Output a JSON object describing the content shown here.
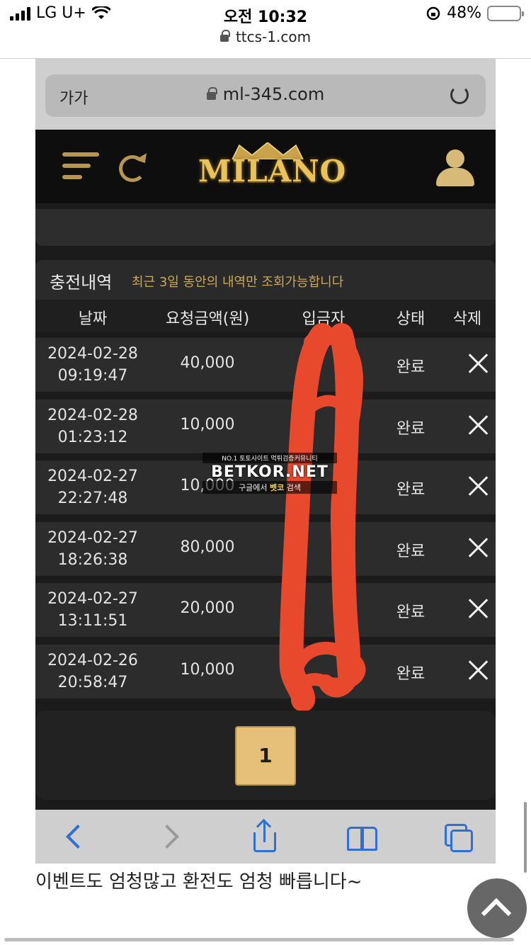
{
  "status_bar": {
    "carrier": "LG U+",
    "time": "오전 10:32",
    "battery": "48%"
  },
  "browser": {
    "url": "ttcs-1.com"
  },
  "embedded": {
    "browser": {
      "aa_label": "가가",
      "url": "ml-345.com"
    },
    "site": {
      "logo": "MILANO"
    },
    "history": {
      "title": "충전내역",
      "note": "최근 3일 동안의 내역만 조회가능합니다",
      "columns": [
        "날짜",
        "요청금액(원)",
        "입금자",
        "상태",
        "삭제"
      ],
      "rows": [
        {
          "date": "2024-02-28",
          "time": "09:19:47",
          "amount": "40,000",
          "status": "완료"
        },
        {
          "date": "2024-02-28",
          "time": "01:23:12",
          "amount": "10,000",
          "status": "완료"
        },
        {
          "date": "2024-02-27",
          "time": "22:27:48",
          "amount": "10,000",
          "status": "완료"
        },
        {
          "date": "2024-02-27",
          "time": "18:26:38",
          "amount": "80,000",
          "status": "완료"
        },
        {
          "date": "2024-02-27",
          "time": "13:11:51",
          "amount": "20,000",
          "status": "완료"
        },
        {
          "date": "2024-02-26",
          "time": "20:58:47",
          "amount": "10,000",
          "status": "완료"
        }
      ]
    },
    "pagination": {
      "current_page": "1"
    },
    "watermark": {
      "line1": "NO.1 토토사이트 먹튀검증커뮤니티",
      "line2": "BETKOR.NET",
      "line3_prefix": "구글에서 ",
      "line3_highlight": "벳코",
      "line3_suffix": " 검색"
    }
  },
  "post": {
    "caption": "이벤트도 엄청많고 환전도 엄청 빠릅니다~"
  },
  "colors": {
    "gold": "#b79750",
    "redaction": "#e8492c",
    "ios_blue": "#2f6fd6"
  }
}
